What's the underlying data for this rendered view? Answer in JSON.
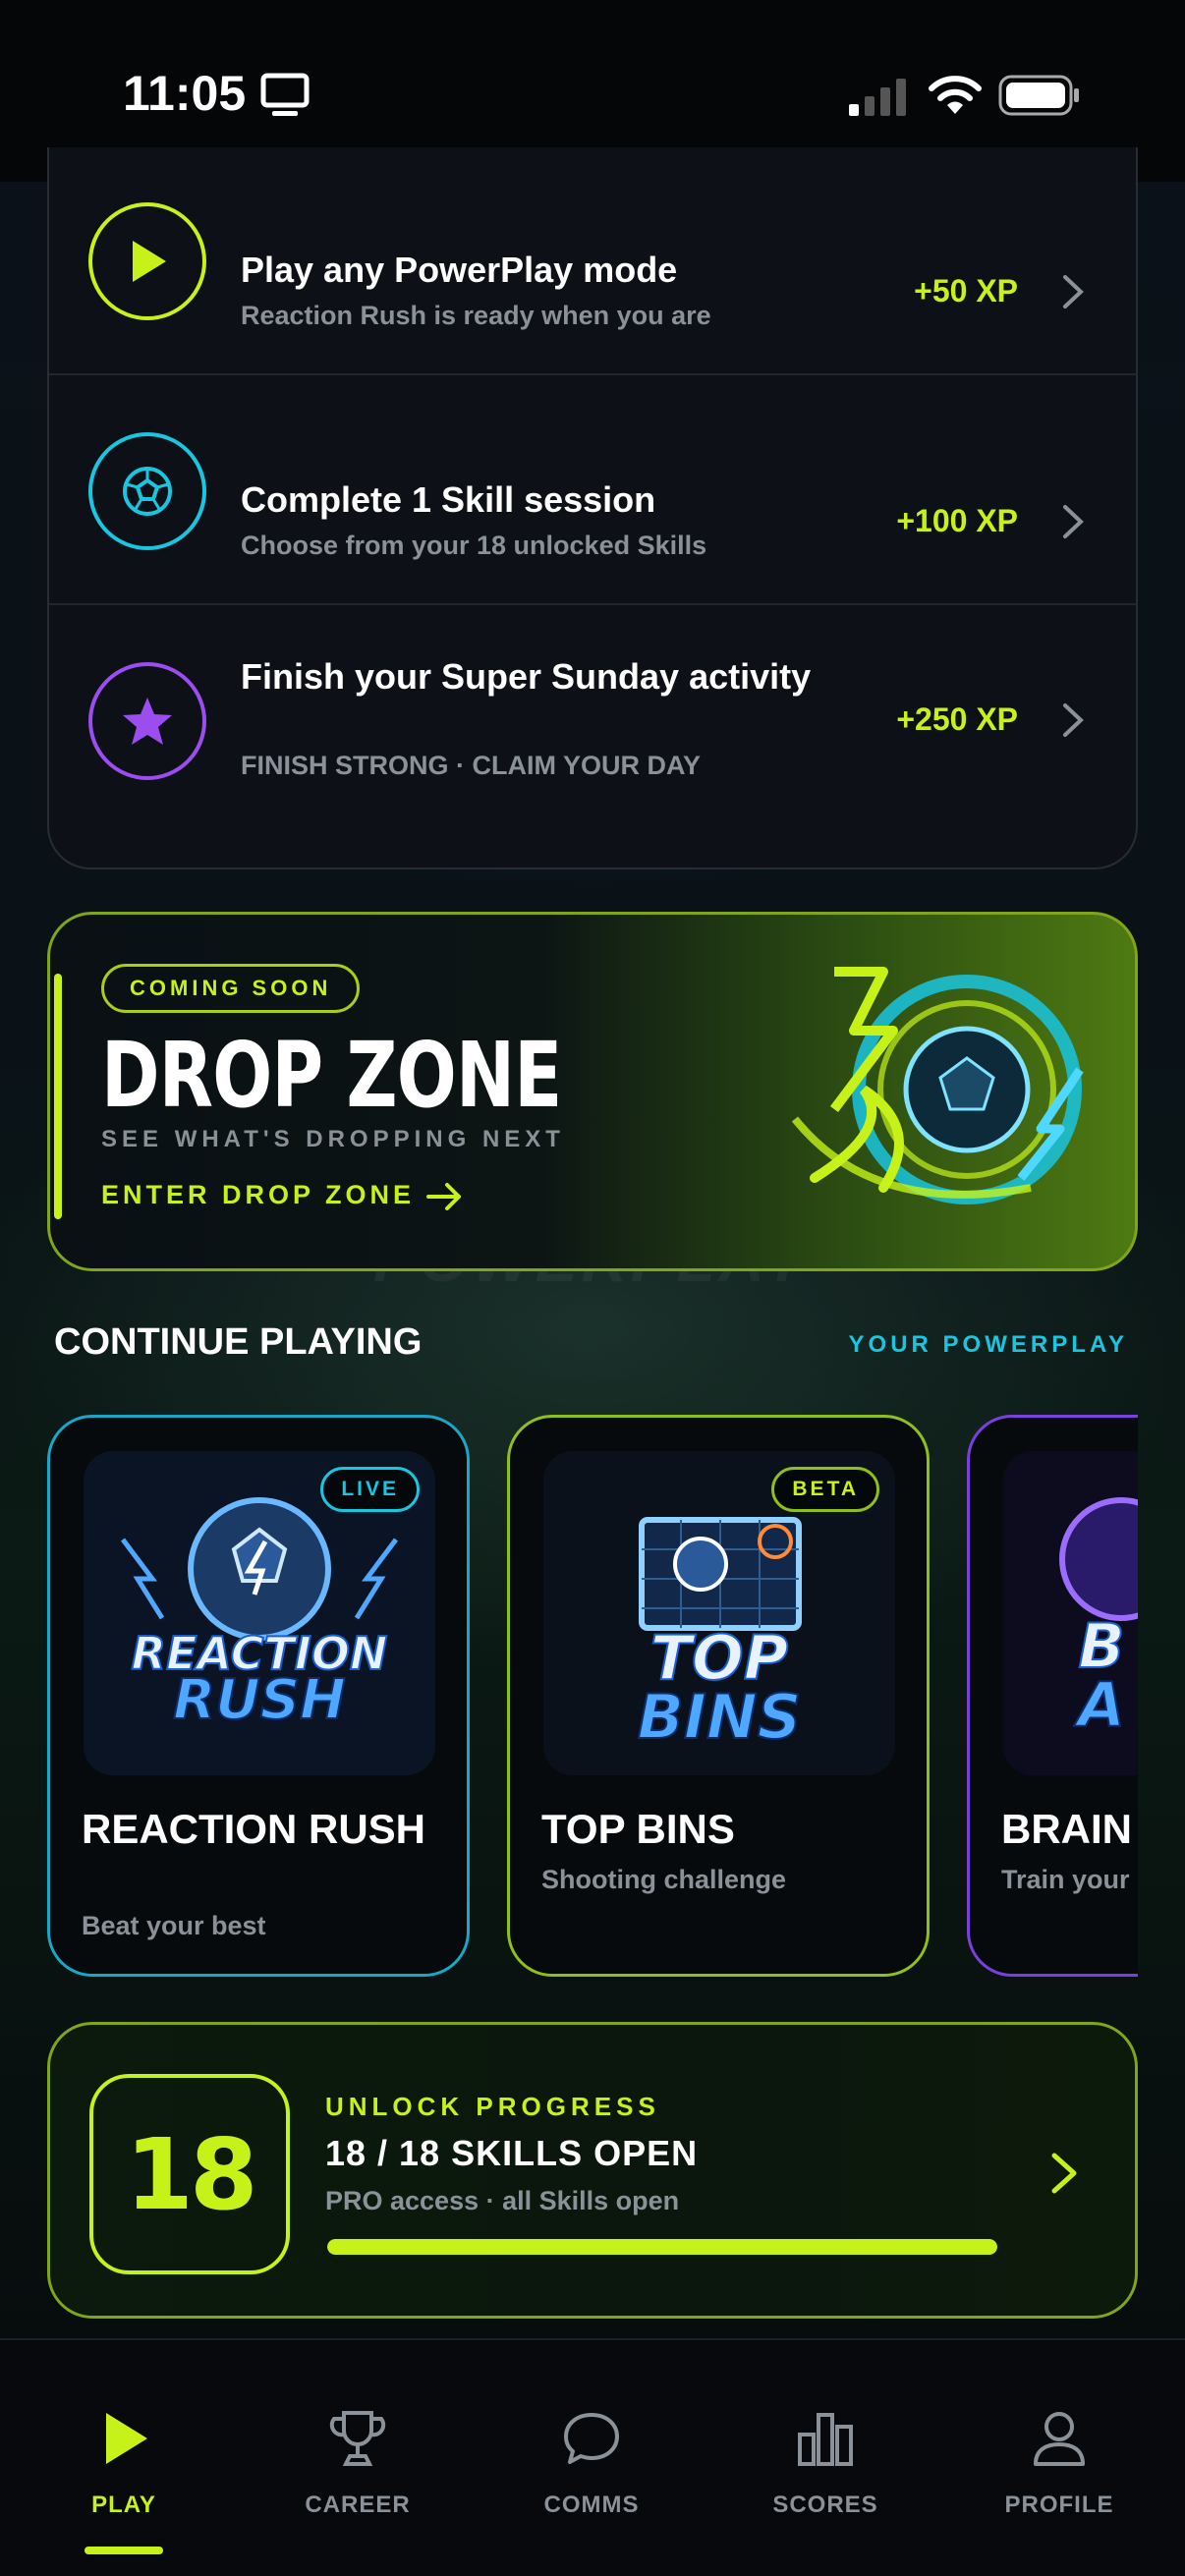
{
  "status_bar": {
    "time": "11:05"
  },
  "missions": [
    {
      "title": "Play any PowerPlay mode",
      "subtitle": "Reaction Rush is ready when you are",
      "xp": "+50 XP",
      "icon": "play-icon",
      "color": "#c6f21a"
    },
    {
      "title": "Complete 1 Skill session",
      "subtitle": "Choose from your 18 unlocked Skills",
      "xp": "+100 XP",
      "icon": "soccer-ball-icon",
      "color": "#19c6e0"
    },
    {
      "title": "Finish your Super Sunday activity",
      "subtitle": "FINISH STRONG · CLAIM YOUR DAY",
      "xp": "+250 XP",
      "icon": "star-icon",
      "color": "#9b4df0"
    }
  ],
  "drop_zone": {
    "badge": "COMING SOON",
    "title": "DROP ZONE",
    "subtitle": "SEE WHAT'S DROPPING NEXT",
    "cta": "ENTER DROP ZONE"
  },
  "background_text": "POWERPLAY",
  "continue_playing": {
    "title": "CONTINUE PLAYING",
    "link": "YOUR POWERPLAY",
    "games": [
      {
        "title": "REACTION RUSH",
        "subtitle": "Beat your best",
        "badge": "LIVE",
        "art_text": [
          "REACTION",
          "RUSH"
        ],
        "color": "#19a7c6"
      },
      {
        "title": "TOP BINS",
        "subtitle": "Shooting challenge",
        "badge": "BETA",
        "art_text": [
          "TOP",
          "BINS"
        ],
        "color": "#8fbf1a"
      },
      {
        "title": "BRAIN",
        "subtitle": "Train your",
        "badge": "",
        "art_text": [
          "B",
          "A"
        ],
        "color": "#7b3fe0"
      }
    ]
  },
  "unlock": {
    "number": "18",
    "label": "UNLOCK PROGRESS",
    "title": "18 / 18 SKILLS OPEN",
    "subtitle": "PRO access · all Skills open",
    "progress": 1.0
  },
  "nav": [
    {
      "label": "PLAY",
      "icon": "play-icon",
      "active": true
    },
    {
      "label": "CAREER",
      "icon": "trophy-icon",
      "active": false
    },
    {
      "label": "COMMS",
      "icon": "chat-icon",
      "active": false
    },
    {
      "label": "SCORES",
      "icon": "bar-chart-icon",
      "active": false
    },
    {
      "label": "PROFILE",
      "icon": "person-icon",
      "active": false
    }
  ],
  "colors": {
    "accent": "#c6f21a",
    "cyan": "#19c6e0",
    "purple": "#9b4df0",
    "muted": "#8b9199"
  }
}
